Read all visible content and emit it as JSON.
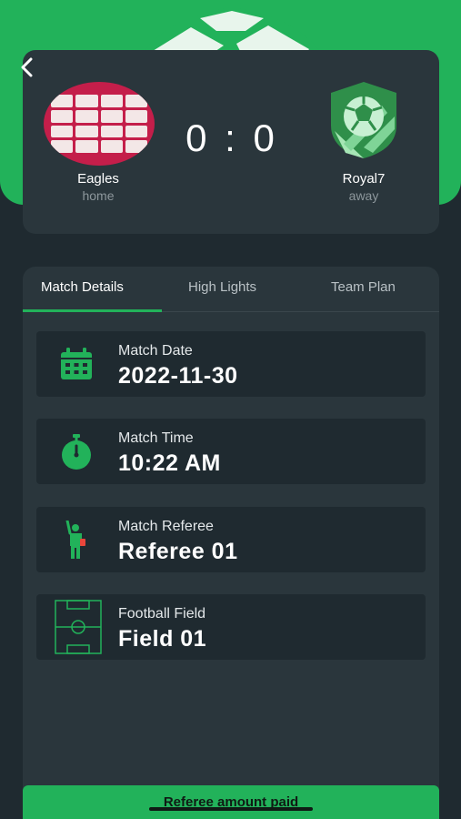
{
  "header": {
    "back_icon": "chevron-left-icon"
  },
  "match": {
    "home": {
      "name": "Eagles",
      "role": "home"
    },
    "away": {
      "name": "Royal7",
      "role": "away"
    },
    "score": "0 : 0"
  },
  "tabs": [
    {
      "label": "Match Details",
      "active": true
    },
    {
      "label": "High Lights",
      "active": false
    },
    {
      "label": "Team Plan",
      "active": false
    }
  ],
  "details": {
    "date": {
      "label": "Match Date",
      "value": "2022-11-30",
      "icon": "calendar-icon"
    },
    "time": {
      "label": "Match Time",
      "value": "10:22 AM",
      "icon": "stopwatch-icon"
    },
    "referee": {
      "label": "Match Referee",
      "value": "Referee 01",
      "icon": "referee-icon"
    },
    "field": {
      "label": "Football Field",
      "value": "Field 01",
      "icon": "football-field-icon"
    }
  },
  "footer": {
    "button_label": "Referee amount paid"
  },
  "colors": {
    "accent": "#22b25a",
    "background": "#1f2a30",
    "card": "#2a363c"
  }
}
